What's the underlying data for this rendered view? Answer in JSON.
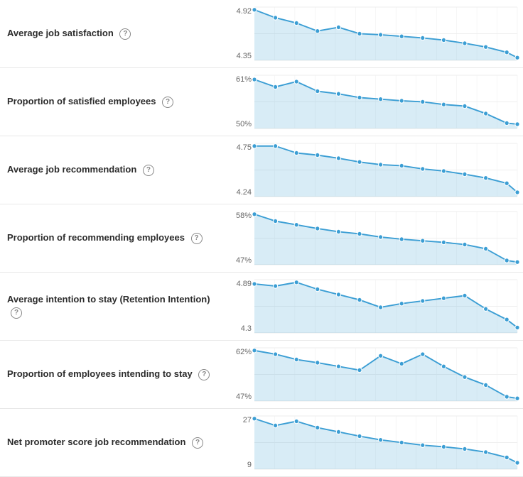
{
  "metrics": [
    {
      "id": "avg-job-satisfaction",
      "title": "Average job satisfaction",
      "yMax": "4.92",
      "yMin": "4.35",
      "chartPoints": [
        [
          0,
          5
        ],
        [
          8,
          20
        ],
        [
          16,
          30
        ],
        [
          24,
          45
        ],
        [
          32,
          38
        ],
        [
          40,
          50
        ],
        [
          48,
          52
        ],
        [
          56,
          55
        ],
        [
          64,
          58
        ],
        [
          72,
          62
        ],
        [
          80,
          68
        ],
        [
          88,
          75
        ],
        [
          96,
          85
        ],
        [
          100,
          95
        ]
      ],
      "shadeBottom": 100
    },
    {
      "id": "proportion-satisfied",
      "title": "Proportion of satisfied employees",
      "yMax": "61%",
      "yMin": "50%",
      "chartPoints": [
        [
          0,
          8
        ],
        [
          8,
          22
        ],
        [
          16,
          12
        ],
        [
          24,
          30
        ],
        [
          32,
          35
        ],
        [
          40,
          42
        ],
        [
          48,
          45
        ],
        [
          56,
          48
        ],
        [
          64,
          50
        ],
        [
          72,
          55
        ],
        [
          80,
          58
        ],
        [
          88,
          72
        ],
        [
          96,
          90
        ],
        [
          100,
          92
        ]
      ],
      "shadeBottom": 100
    },
    {
      "id": "avg-job-recommendation",
      "title": "Average job recommendation",
      "yMax": "4.75",
      "yMin": "4.24",
      "chartPoints": [
        [
          0,
          5
        ],
        [
          8,
          5
        ],
        [
          16,
          18
        ],
        [
          24,
          22
        ],
        [
          32,
          28
        ],
        [
          40,
          35
        ],
        [
          48,
          40
        ],
        [
          56,
          42
        ],
        [
          64,
          48
        ],
        [
          72,
          52
        ],
        [
          80,
          58
        ],
        [
          88,
          65
        ],
        [
          96,
          75
        ],
        [
          100,
          92
        ]
      ],
      "shadeBottom": 100
    },
    {
      "id": "proportion-recommending",
      "title": "Proportion of recommending employees",
      "yMax": "58%",
      "yMin": "47%",
      "chartPoints": [
        [
          0,
          5
        ],
        [
          8,
          18
        ],
        [
          16,
          25
        ],
        [
          24,
          32
        ],
        [
          32,
          38
        ],
        [
          40,
          42
        ],
        [
          48,
          48
        ],
        [
          56,
          52
        ],
        [
          64,
          55
        ],
        [
          72,
          58
        ],
        [
          80,
          62
        ],
        [
          88,
          70
        ],
        [
          96,
          92
        ],
        [
          100,
          95
        ]
      ],
      "shadeBottom": 100
    },
    {
      "id": "avg-intention-stay",
      "title": "Average intention to stay (Retention Intention)",
      "yMax": "4.89",
      "yMin": "4.3",
      "chartPoints": [
        [
          0,
          8
        ],
        [
          8,
          12
        ],
        [
          16,
          5
        ],
        [
          24,
          18
        ],
        [
          32,
          28
        ],
        [
          40,
          38
        ],
        [
          48,
          52
        ],
        [
          56,
          45
        ],
        [
          64,
          40
        ],
        [
          72,
          35
        ],
        [
          80,
          30
        ],
        [
          88,
          55
        ],
        [
          96,
          75
        ],
        [
          100,
          90
        ]
      ],
      "shadeBottom": 100
    },
    {
      "id": "proportion-intending-stay",
      "title": "Proportion of employees intending to stay",
      "yMax": "62%",
      "yMin": "47%",
      "chartPoints": [
        [
          0,
          5
        ],
        [
          8,
          12
        ],
        [
          16,
          22
        ],
        [
          24,
          28
        ],
        [
          32,
          35
        ],
        [
          40,
          42
        ],
        [
          48,
          15
        ],
        [
          56,
          30
        ],
        [
          64,
          12
        ],
        [
          72,
          35
        ],
        [
          80,
          55
        ],
        [
          88,
          70
        ],
        [
          96,
          92
        ],
        [
          100,
          95
        ]
      ],
      "shadeBottom": 100
    },
    {
      "id": "net-promoter-score",
      "title": "Net promoter score job recommendation",
      "yMax": "27",
      "yMin": "9",
      "chartPoints": [
        [
          0,
          5
        ],
        [
          8,
          18
        ],
        [
          16,
          10
        ],
        [
          24,
          22
        ],
        [
          32,
          30
        ],
        [
          40,
          38
        ],
        [
          48,
          45
        ],
        [
          56,
          50
        ],
        [
          64,
          55
        ],
        [
          72,
          58
        ],
        [
          80,
          62
        ],
        [
          88,
          68
        ],
        [
          96,
          78
        ],
        [
          100,
          88
        ]
      ],
      "shadeBottom": 100
    }
  ],
  "helpIcon": "?"
}
